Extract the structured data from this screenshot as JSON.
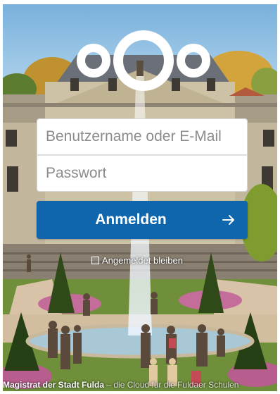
{
  "login": {
    "username_placeholder": "Benutzername oder E-Mail",
    "password_placeholder": "Passwort",
    "submit_label": "Anmelden",
    "remember_label": "Angemeldet bleiben"
  },
  "footer": {
    "entity": "Magistrat der Stadt Fulda",
    "separator": " – ",
    "slogan": "die Cloud für die Fuldaer Schulen"
  },
  "icons": {
    "logo": "nextcloud-logo-icon",
    "submit": "arrow-right-icon",
    "remember": "checkbox-icon"
  },
  "colors": {
    "primary": "#0f66ad",
    "text_on_primary": "#ffffff",
    "input_background": "#ffffff",
    "placeholder": "#8b8b8b"
  }
}
